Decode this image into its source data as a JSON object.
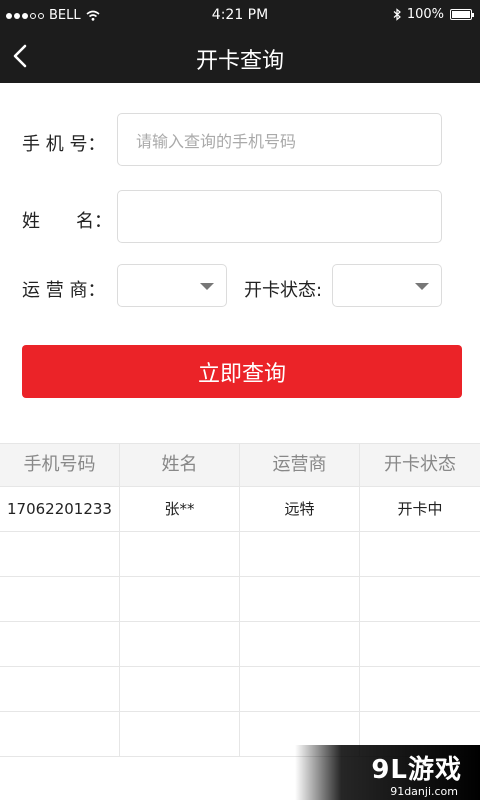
{
  "status_bar": {
    "carrier": "BELL",
    "time": "4:21 PM",
    "battery": "100%",
    "battery_level": 1.0
  },
  "nav": {
    "title": "开卡查询",
    "back_icon": "chevron-left-icon"
  },
  "form": {
    "phone_label": "手 机 号：",
    "phone_placeholder": "请输入查询的手机号码",
    "name_label": "姓　　名：",
    "carrier_label": "运 营 商：",
    "carrier_value": "",
    "status_label": "开卡状态:",
    "status_value": ""
  },
  "query_button": "立即查询",
  "table": {
    "headers": [
      "手机号码",
      "姓名",
      "运营商",
      "开卡状态"
    ],
    "rows": [
      [
        "17062201233",
        "张**",
        "远特",
        "开卡中"
      ],
      [
        "",
        "",
        "",
        ""
      ],
      [
        "",
        "",
        "",
        ""
      ],
      [
        "",
        "",
        "",
        ""
      ],
      [
        "",
        "",
        "",
        ""
      ],
      [
        "",
        "",
        "",
        ""
      ]
    ]
  },
  "watermark": {
    "logo": "9L游戏",
    "url": "91danji.com"
  },
  "colors": {
    "accent": "#eb2328",
    "header_bg": "#1c1c1c"
  }
}
